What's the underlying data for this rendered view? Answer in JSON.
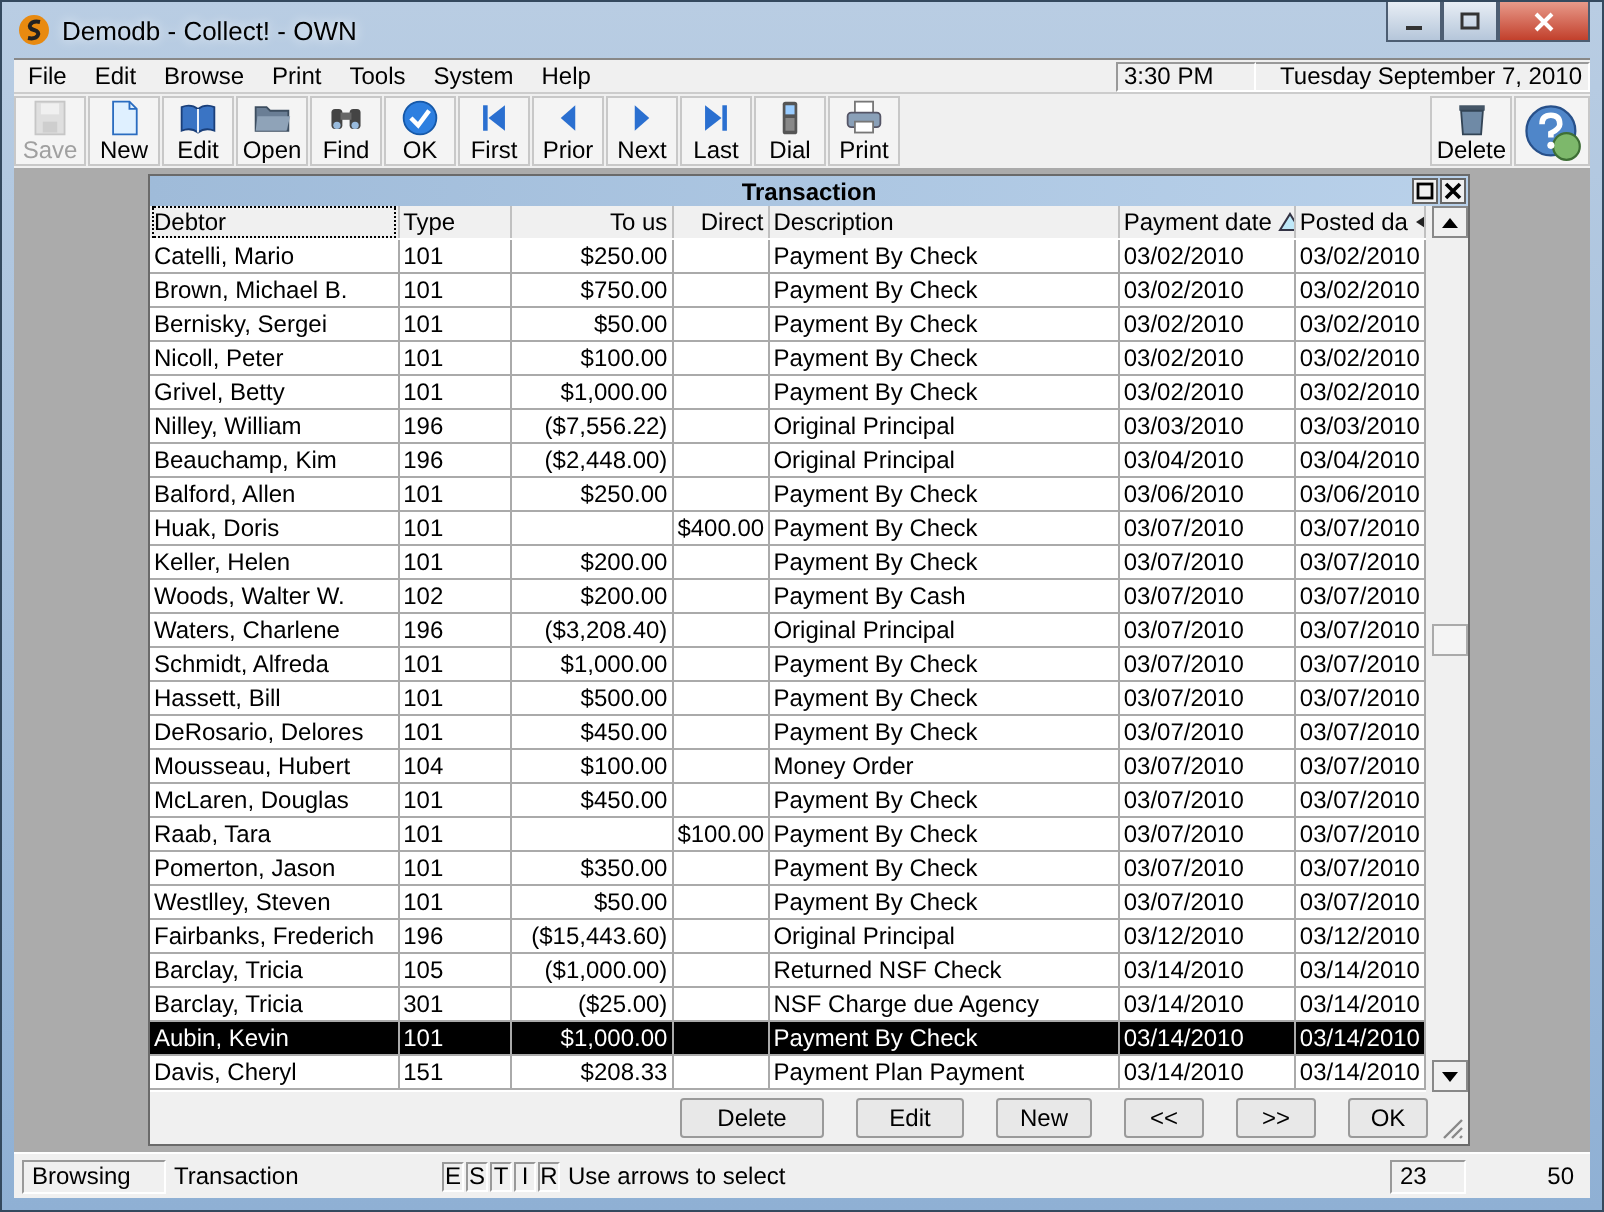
{
  "window": {
    "title": "Demodb - Collect! - OWN"
  },
  "menu": [
    "File",
    "Edit",
    "Browse",
    "Print",
    "Tools",
    "System",
    "Help"
  ],
  "clock": {
    "time": "3:30 PM",
    "date": "Tuesday  September 7, 2010"
  },
  "toolbar": [
    {
      "kind": "save",
      "label": "Save",
      "disabled": true
    },
    {
      "kind": "new",
      "label": "New",
      "disabled": false
    },
    {
      "kind": "edit",
      "label": "Edit",
      "disabled": false
    },
    {
      "kind": "open",
      "label": "Open",
      "disabled": false
    },
    {
      "kind": "find",
      "label": "Find",
      "disabled": false
    },
    {
      "kind": "ok",
      "label": "OK",
      "disabled": false
    },
    {
      "kind": "first",
      "label": "First",
      "disabled": false
    },
    {
      "kind": "prior",
      "label": "Prior",
      "disabled": false
    },
    {
      "kind": "next",
      "label": "Next",
      "disabled": false
    },
    {
      "kind": "last",
      "label": "Last",
      "disabled": false
    },
    {
      "kind": "dial",
      "label": "Dial",
      "disabled": false
    },
    {
      "kind": "print",
      "label": "Print",
      "disabled": false
    }
  ],
  "toolbar_right": [
    {
      "kind": "delete",
      "label": "Delete",
      "disabled": false
    },
    {
      "kind": "help",
      "disabled": false
    }
  ],
  "panel": {
    "title": "Transaction",
    "columns": [
      {
        "label": "Debtor",
        "numeric": false,
        "kind": "plain"
      },
      {
        "label": "Type",
        "numeric": false,
        "kind": "plain"
      },
      {
        "label": "To us",
        "numeric": true,
        "kind": "plain"
      },
      {
        "label": "Direct",
        "numeric": true,
        "kind": "plain"
      },
      {
        "label": "Description",
        "numeric": false,
        "kind": "plain"
      },
      {
        "label": "Payment date",
        "numeric": false,
        "kind": "sorted"
      },
      {
        "label": "Posted da",
        "numeric": false,
        "kind": "truncated"
      }
    ],
    "rows": [
      {
        "cells": [
          "Catelli, Mario",
          "101",
          "$250.00",
          "",
          "Payment By Check",
          "03/02/2010",
          "03/02/2010"
        ],
        "selected": false
      },
      {
        "cells": [
          "Brown, Michael B.",
          "101",
          "$750.00",
          "",
          "Payment By Check",
          "03/02/2010",
          "03/02/2010"
        ],
        "selected": false
      },
      {
        "cells": [
          "Bernisky, Sergei",
          "101",
          "$50.00",
          "",
          "Payment By Check",
          "03/02/2010",
          "03/02/2010"
        ],
        "selected": false
      },
      {
        "cells": [
          "Nicoll, Peter",
          "101",
          "$100.00",
          "",
          "Payment By Check",
          "03/02/2010",
          "03/02/2010"
        ],
        "selected": false
      },
      {
        "cells": [
          "Grivel, Betty",
          "101",
          "$1,000.00",
          "",
          "Payment By Check",
          "03/02/2010",
          "03/02/2010"
        ],
        "selected": false
      },
      {
        "cells": [
          "Nilley, William",
          "196",
          "($7,556.22)",
          "",
          "Original Principal",
          "03/03/2010",
          "03/03/2010"
        ],
        "selected": false
      },
      {
        "cells": [
          "Beauchamp, Kim",
          "196",
          "($2,448.00)",
          "",
          "Original Principal",
          "03/04/2010",
          "03/04/2010"
        ],
        "selected": false
      },
      {
        "cells": [
          "Balford, Allen",
          "101",
          "$250.00",
          "",
          "Payment By Check",
          "03/06/2010",
          "03/06/2010"
        ],
        "selected": false
      },
      {
        "cells": [
          "Huak, Doris",
          "101",
          "",
          "$400.00",
          "Payment By Check",
          "03/07/2010",
          "03/07/2010"
        ],
        "selected": false
      },
      {
        "cells": [
          "Keller, Helen",
          "101",
          "$200.00",
          "",
          "Payment By Check",
          "03/07/2010",
          "03/07/2010"
        ],
        "selected": false
      },
      {
        "cells": [
          "Woods, Walter W.",
          "102",
          "$200.00",
          "",
          "Payment By Cash",
          "03/07/2010",
          "03/07/2010"
        ],
        "selected": false
      },
      {
        "cells": [
          "Waters, Charlene",
          "196",
          "($3,208.40)",
          "",
          "Original Principal",
          "03/07/2010",
          "03/07/2010"
        ],
        "selected": false
      },
      {
        "cells": [
          "Schmidt, Alfreda",
          "101",
          "$1,000.00",
          "",
          "Payment By Check",
          "03/07/2010",
          "03/07/2010"
        ],
        "selected": false
      },
      {
        "cells": [
          "Hassett, Bill",
          "101",
          "$500.00",
          "",
          "Payment By Check",
          "03/07/2010",
          "03/07/2010"
        ],
        "selected": false
      },
      {
        "cells": [
          "DeRosario, Delores",
          "101",
          "$450.00",
          "",
          "Payment By Check",
          "03/07/2010",
          "03/07/2010"
        ],
        "selected": false
      },
      {
        "cells": [
          "Mousseau, Hubert",
          "104",
          "$100.00",
          "",
          "Money Order",
          "03/07/2010",
          "03/07/2010"
        ],
        "selected": false
      },
      {
        "cells": [
          "McLaren, Douglas",
          "101",
          "$450.00",
          "",
          "Payment By Check",
          "03/07/2010",
          "03/07/2010"
        ],
        "selected": false
      },
      {
        "cells": [
          "Raab, Tara",
          "101",
          "",
          "$100.00",
          "Payment By Check",
          "03/07/2010",
          "03/07/2010"
        ],
        "selected": false
      },
      {
        "cells": [
          "Pomerton, Jason",
          "101",
          "$350.00",
          "",
          "Payment By Check",
          "03/07/2010",
          "03/07/2010"
        ],
        "selected": false
      },
      {
        "cells": [
          "Westlley, Steven",
          "101",
          "$50.00",
          "",
          "Payment By Check",
          "03/07/2010",
          "03/07/2010"
        ],
        "selected": false
      },
      {
        "cells": [
          "Fairbanks, Frederich",
          "196",
          "($15,443.60)",
          "",
          "Original Principal",
          "03/12/2010",
          "03/12/2010"
        ],
        "selected": false
      },
      {
        "cells": [
          "Barclay, Tricia",
          "105",
          "($1,000.00)",
          "",
          "Returned NSF Check",
          "03/14/2010",
          "03/14/2010"
        ],
        "selected": false
      },
      {
        "cells": [
          "Barclay, Tricia",
          "301",
          "($25.00)",
          "",
          "NSF Charge due Agency",
          "03/14/2010",
          "03/14/2010"
        ],
        "selected": false
      },
      {
        "cells": [
          "Aubin, Kevin",
          "101",
          "$1,000.00",
          "",
          "Payment By Check",
          "03/14/2010",
          "03/14/2010"
        ],
        "selected": true
      },
      {
        "cells": [
          "Davis, Cheryl",
          "151",
          "$208.33",
          "",
          "Payment Plan Payment",
          "03/14/2010",
          "03/14/2010"
        ],
        "selected": false
      }
    ],
    "buttons": [
      "Delete",
      "Edit",
      "New",
      "<<",
      ">>",
      "OK"
    ]
  },
  "status_bar": {
    "mode": "Browsing",
    "form": "Transaction",
    "flags": [
      "E",
      "S",
      "T",
      "I",
      "R"
    ],
    "hint": "Use arrows to select",
    "count": "23",
    "total": "50"
  }
}
